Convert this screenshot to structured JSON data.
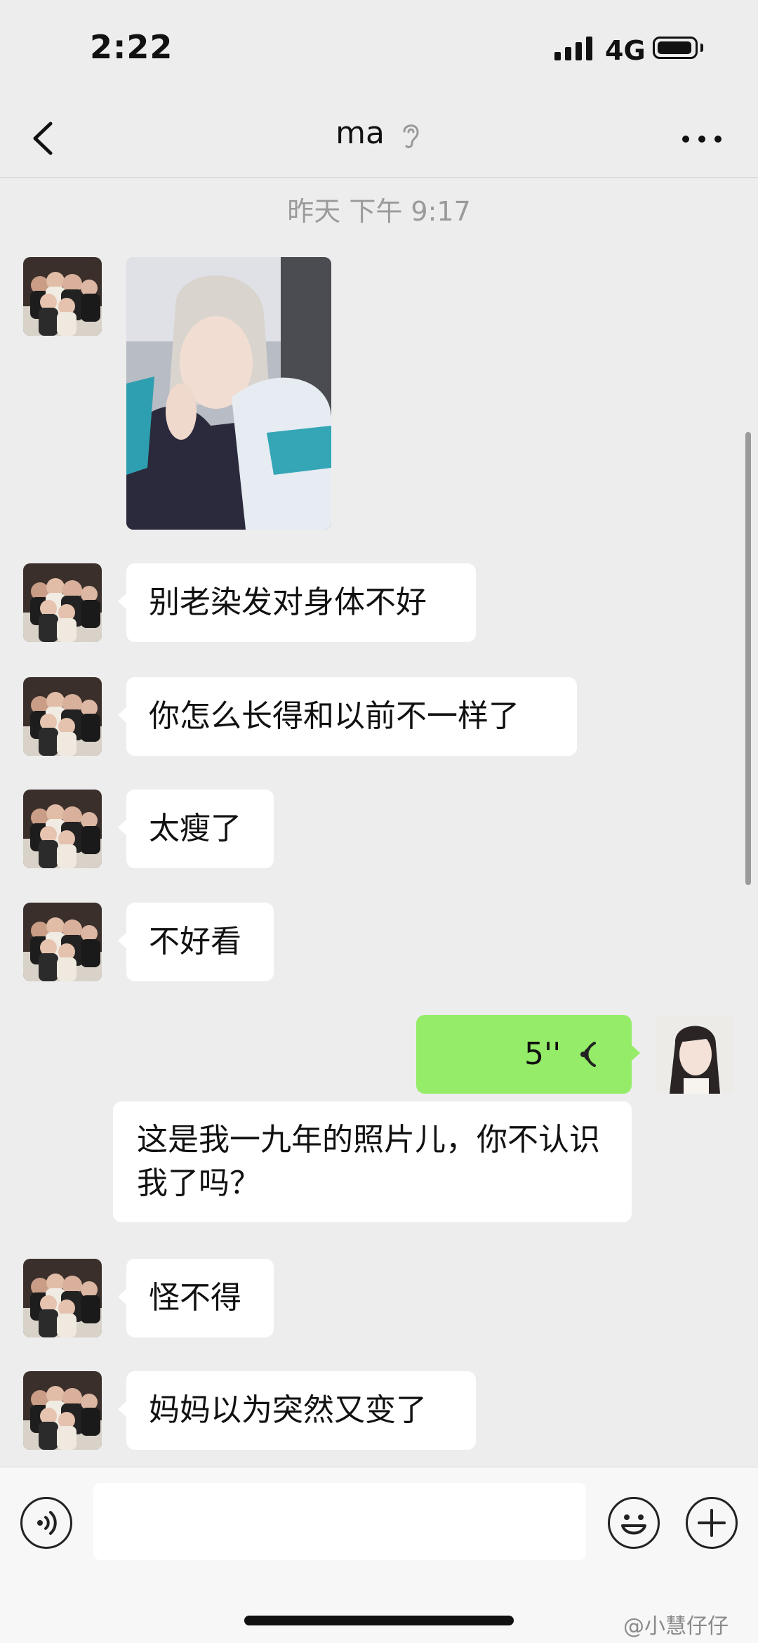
{
  "status_bar": {
    "time": "2:22",
    "network": "4G",
    "battery_level": 0.95
  },
  "nav": {
    "title": "ma",
    "back_icon": "chevron-left-icon",
    "muted_icon": "ear-icon",
    "more_icon": "more-dots-icon"
  },
  "chat": {
    "timestamp": "昨天 下午 9:17",
    "messages": [
      {
        "sender": "ma",
        "type": "image"
      },
      {
        "sender": "ma",
        "type": "text",
        "text": "别老染发对身体不好"
      },
      {
        "sender": "ma",
        "type": "text",
        "text": "你怎么长得和以前不一样了"
      },
      {
        "sender": "ma",
        "type": "text",
        "text": "太瘦了"
      },
      {
        "sender": "ma",
        "type": "text",
        "text": "不好看"
      },
      {
        "sender": "me",
        "type": "voice",
        "duration": "5''",
        "transcript": "这是我一九年的照片儿，你不认识我了吗？"
      },
      {
        "sender": "ma",
        "type": "text",
        "text": "怪不得"
      },
      {
        "sender": "ma",
        "type": "text",
        "text": "妈妈以为突然又变了"
      }
    ]
  },
  "input_bar": {
    "voice_icon": "voice-input-icon",
    "emoji_icon": "emoji-icon",
    "plus_icon": "plus-icon",
    "input_value": ""
  },
  "watermark": "@小慧仔仔",
  "colors": {
    "background": "#ededed",
    "voice_bubble": "#95ec69",
    "bubble": "#ffffff"
  }
}
